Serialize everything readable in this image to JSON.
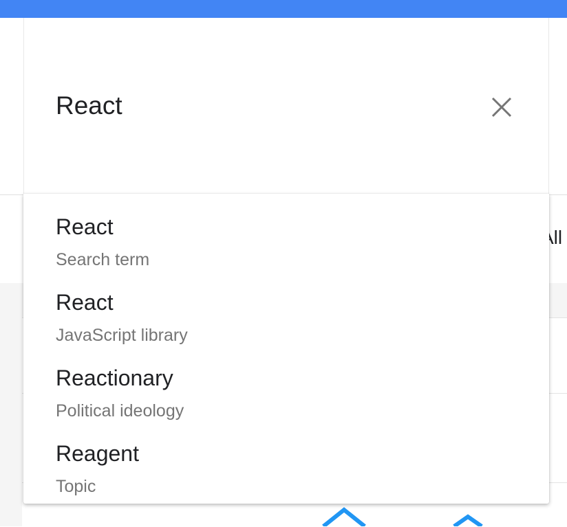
{
  "search": {
    "query": "React"
  },
  "icons": {
    "close": "close-icon"
  },
  "suggestions": [
    {
      "title": "React",
      "subtitle": "Search term"
    },
    {
      "title": "React",
      "subtitle": "JavaScript library"
    },
    {
      "title": "Reactionary",
      "subtitle": "Political ideology"
    },
    {
      "title": "Reagent",
      "subtitle": "Topic"
    }
  ],
  "background": {
    "partial_text": "All"
  },
  "colors": {
    "header": "#4285f4",
    "chart_line": "#2196f3",
    "primary_text": "#202124",
    "secondary_text": "#757575"
  }
}
